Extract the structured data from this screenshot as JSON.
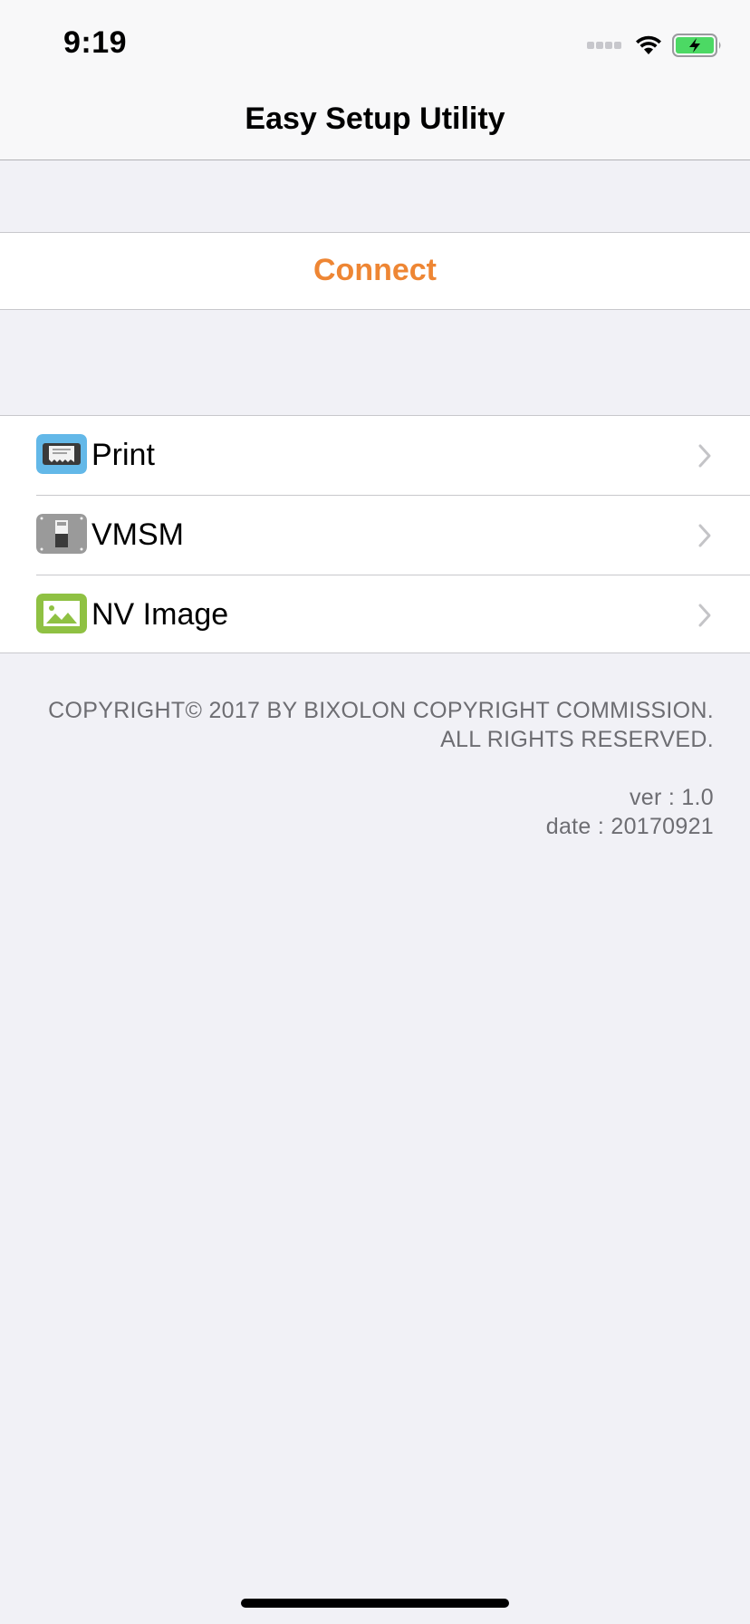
{
  "status_bar": {
    "time": "9:19",
    "icons": [
      "cellular-signal-icon",
      "wifi-icon",
      "battery-charging-icon"
    ],
    "battery_color": "#4cd964"
  },
  "nav": {
    "title": "Easy Setup Utility"
  },
  "connect": {
    "label": "Connect",
    "color": "#ee8634"
  },
  "menu": {
    "items": [
      {
        "label": "Print",
        "icon": "printer-icon",
        "icon_color": "#63b8e8"
      },
      {
        "label": "VMSM",
        "icon": "switch-icon",
        "icon_color": "#9a9a9a"
      },
      {
        "label": "NV Image",
        "icon": "image-icon",
        "icon_color": "#8fc143"
      }
    ]
  },
  "footer": {
    "copyright_line1": "COPYRIGHT© 2017 BY BIXOLON COPYRIGHT COMMISSION.",
    "copyright_line2": "ALL RIGHTS RESERVED.",
    "version": "ver : 1.0",
    "date": "date : 20170921"
  }
}
